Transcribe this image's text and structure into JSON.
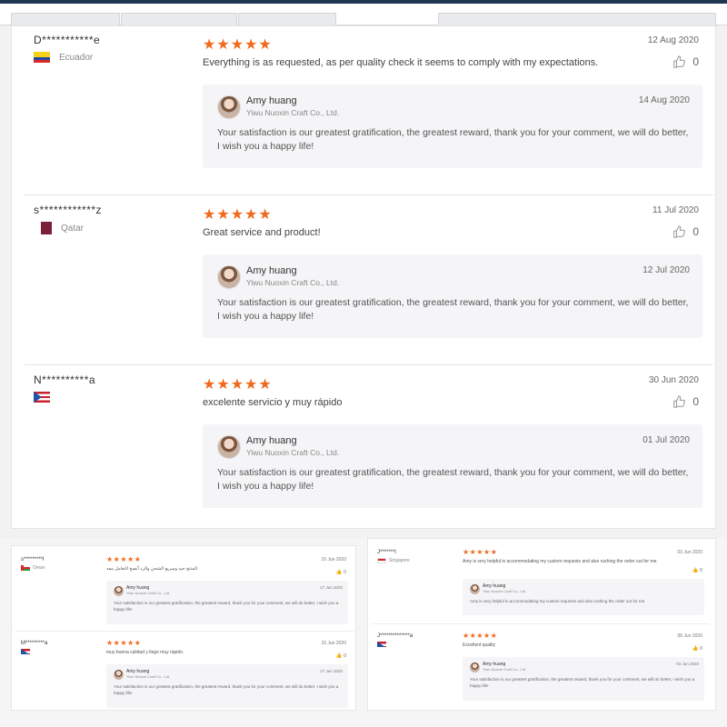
{
  "reviews": [
    {
      "user": "D***********e",
      "country": "Ecuador",
      "rating": 5,
      "stars": "★★★★★",
      "date": "12 Aug 2020",
      "text": "Everything is as requested, as per quality check it seems to comply with my expectations.",
      "likes": "0",
      "reply": {
        "name": "Amy huang",
        "company": "Yiwu Nuoxin Craft Co., Ltd.",
        "date": "14 Aug 2020",
        "text": "Your satisfaction is our greatest gratification, the greatest reward, thank you for your comment, we will do better, I wish you a happy life!"
      }
    },
    {
      "user": "s************z",
      "country": "Qatar",
      "rating": 5,
      "stars": "★★★★★",
      "date": "11 Jul 2020",
      "text": "Great service and product!",
      "likes": "0",
      "reply": {
        "name": "Amy huang",
        "company": "Yiwu Nuoxin Craft Co., Ltd.",
        "date": "12 Jul 2020",
        "text": "Your satisfaction is our greatest gratification, the greatest reward, thank you for your comment, we will do better, I wish you a happy life!"
      }
    },
    {
      "user": "N**********a",
      "country": "",
      "rating": 5,
      "stars": "★★★★★",
      "date": "30 Jun 2020",
      "text": "excelente servicio y muy rápido",
      "likes": "0",
      "reply": {
        "name": "Amy huang",
        "company": "Yiwu Nuoxin Craft Co., Ltd.",
        "date": "01 Jul 2020",
        "text": "Your satisfaction is our greatest gratification, the greatest reward, thank you for your comment, we will do better, I wish you a happy life!"
      }
    }
  ],
  "thumbs_left": [
    {
      "user": "s*********l",
      "country": "Oman",
      "stars": "★★★★★",
      "date": "16 Jun 2020",
      "text": "المنتج جيد وسريع الشحن والرد أنصح التعامل معه",
      "likes": "0",
      "reply": {
        "name": "Amy huang",
        "company": "Yiwu Nuoxin Craft Co., Ltd.",
        "date": "17 Jun 2020",
        "text": "Your satisfaction is our greatest gratification, the greatest reward, thank you for your comment, we will do better, I wish you a happy life!"
      }
    },
    {
      "user": "M*********a",
      "country": "",
      "stars": "★★★★★",
      "date": "15 Jun 2020",
      "text": "muy buena calidad y llego muy rápido.",
      "likes": "0",
      "reply": {
        "name": "Amy huang",
        "company": "Yiwu Nuoxin Craft Co., Ltd.",
        "date": "17 Jun 2020",
        "text": "Your satisfaction is our greatest gratification, the greatest reward, thank you for your comment, we will do better, I wish you a happy life!"
      }
    }
  ],
  "thumbs_right": [
    {
      "user": "J*******l",
      "country": "Singapore",
      "stars": "★★★★★",
      "date": "03 Jun 2020",
      "text": "Amy is very helpful in accommodating my custom requests and also rushing the order out for me.",
      "likes": "0",
      "reply": {
        "name": "Amy huang",
        "company": "Yiwu Nuoxin Craft Co., Ltd.",
        "date": "",
        "text": "Amy is very helpful in accommodating my custom requests and also rushing the order out for me."
      }
    },
    {
      "user": "J**************a",
      "country": "",
      "stars": "★★★★★",
      "date": "06 Jun 2020",
      "text": "Excellent quality",
      "likes": "0",
      "reply": {
        "name": "Amy huang",
        "company": "Yiwu Nuoxin Craft Co., Ltd.",
        "date": "03 Jun 2020",
        "text": "Your satisfaction is our greatest gratification, the greatest reward, thank you for your comment, we will do better, I wish you a happy life!"
      }
    }
  ]
}
